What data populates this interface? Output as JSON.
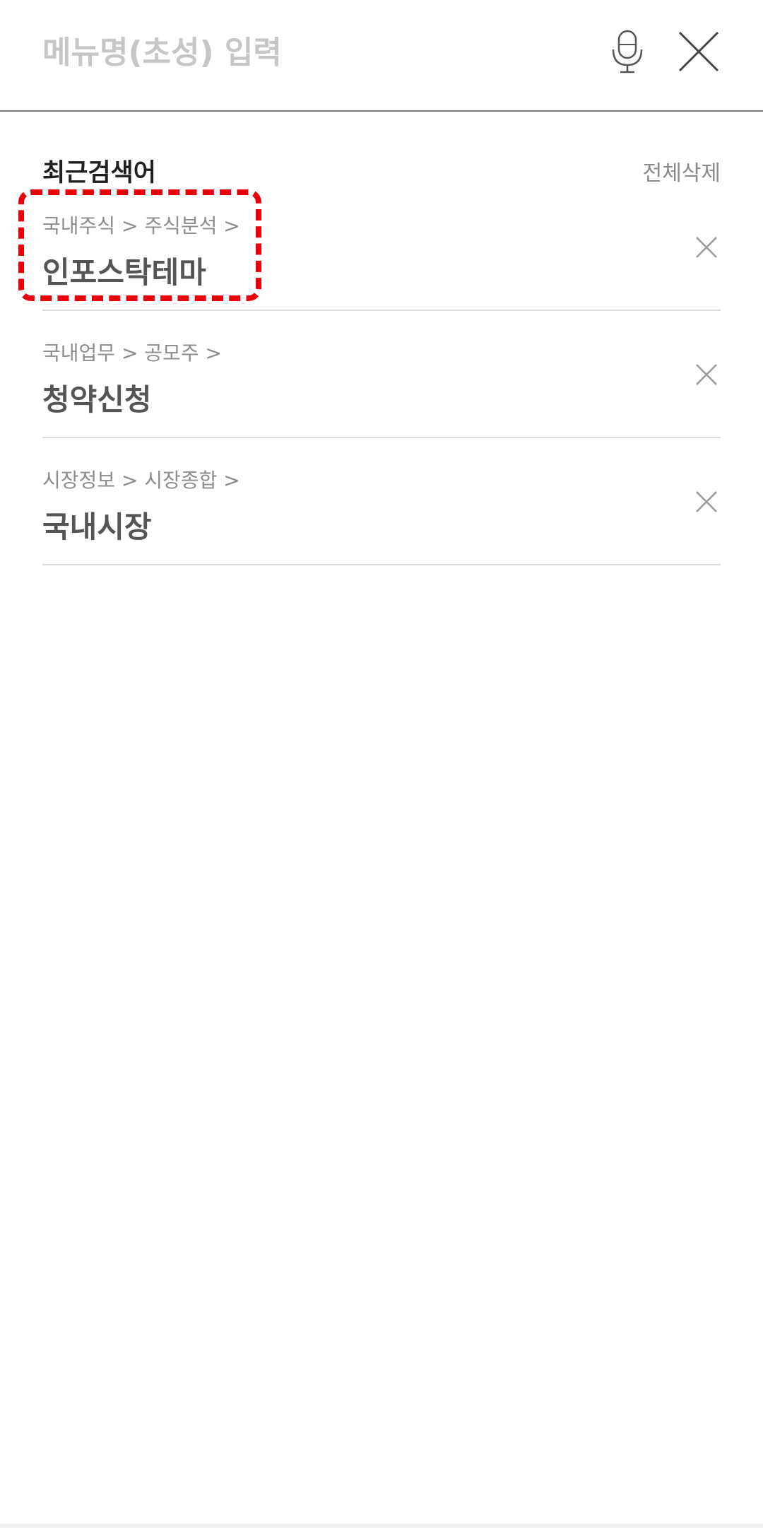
{
  "search": {
    "placeholder": "메뉴명(초성) 입력",
    "value": ""
  },
  "recent": {
    "title": "최근검색어",
    "clear_all_label": "전체삭제",
    "items": [
      {
        "path": "국내주식 > 주식분석 >",
        "title": "인포스탁테마"
      },
      {
        "path": "국내업무 > 공모주 >",
        "title": "청약신청"
      },
      {
        "path": "시장정보 > 시장종합 >",
        "title": "국내시장"
      }
    ]
  },
  "icons": {
    "mic": "microphone-icon",
    "close": "close-icon",
    "delete": "delete-x-icon"
  },
  "colors": {
    "highlight": "#e8000b",
    "placeholder": "#c6c6c6",
    "divider": "#dcdcdc"
  }
}
